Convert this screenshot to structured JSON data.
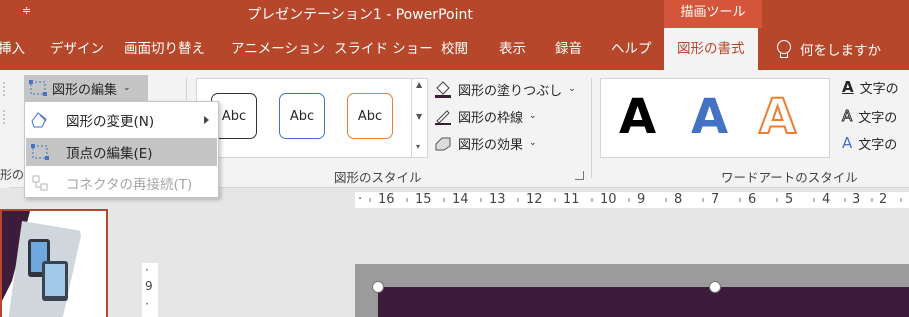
{
  "titlebar": {
    "qat_icon": "customize-qat-icon",
    "title": "プレゼンテーション1  -  PowerPoint",
    "context_tab": "描画ツール"
  },
  "tabs": [
    {
      "label": "挿入"
    },
    {
      "label": "デザイン"
    },
    {
      "label": "画面切り替え"
    },
    {
      "label": "アニメーション"
    },
    {
      "label": "スライド ショー"
    },
    {
      "label": "校閲"
    },
    {
      "label": "表示"
    },
    {
      "label": "録音"
    },
    {
      "label": "ヘルプ"
    },
    {
      "label": "図形の書式"
    }
  ],
  "tell_me": "何をしますか",
  "ribbon": {
    "edit_shape": "図形の編集",
    "left_group_cut": "形の挿",
    "shape_styles": {
      "gallery": [
        "Abc",
        "Abc",
        "Abc"
      ],
      "fill": "図形の塗りつぶし",
      "outline": "図形の枠線",
      "effects": "図形の効果",
      "label": "図形のスタイル"
    },
    "wordart": {
      "letters": [
        "A",
        "A",
        "A"
      ],
      "text_fill": "文字の",
      "text_outline": "文字の",
      "text_effects": "文字の",
      "label": "ワードアートのスタイル"
    }
  },
  "menu": {
    "items": [
      {
        "label": "図形の変更(N)",
        "state": "normal"
      },
      {
        "label": "頂点の編集(E)",
        "state": "highlighted"
      },
      {
        "label": "コネクタの再接続(T)",
        "state": "disabled"
      }
    ]
  },
  "ruler": {
    "horizontal": [
      "16",
      "15",
      "14",
      "13",
      "12",
      "11",
      "10",
      "9",
      "8",
      "7",
      "6",
      "5",
      "4",
      "3",
      "2"
    ],
    "vertical": [
      "9"
    ]
  },
  "colors": {
    "brand": "#b7472a",
    "shape_fill": "#3d1b3b",
    "wordart_blue": "#4472c4",
    "wordart_orange": "#ed7d31"
  }
}
